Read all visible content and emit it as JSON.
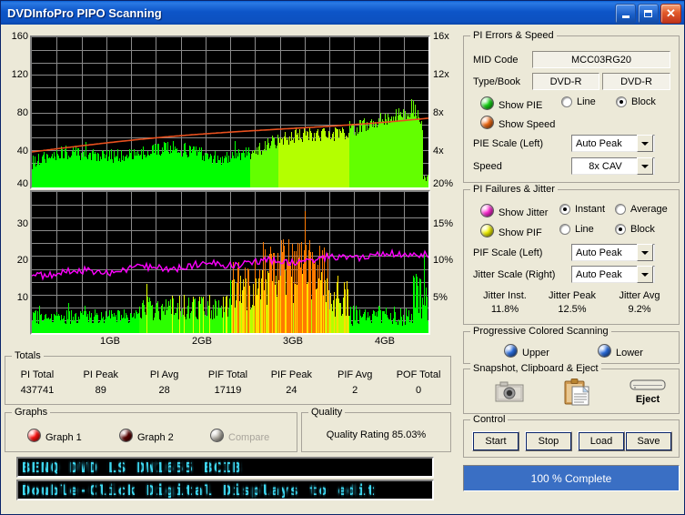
{
  "window": {
    "title": "DVDInfoPro PIPO Scanning",
    "buttons": {
      "minimize": "_",
      "maximize": "□",
      "close": "✕"
    }
  },
  "chart_data": [
    {
      "type": "bar",
      "title": "PI Errors & Speed",
      "xlabel": "",
      "ylabel": "PI Errors",
      "xticks": [
        "1GB",
        "2GB",
        "3GB",
        "4GB"
      ],
      "yticks_left": [
        160,
        120,
        80,
        40
      ],
      "ylim_left": [
        0,
        180
      ],
      "yticks_right": [
        "16x",
        "12x",
        "8x",
        "4x"
      ],
      "ylim_right": [
        0,
        18
      ],
      "grid": true,
      "series": [
        {
          "name": "PI Errors",
          "color": "#00ff00",
          "kind": "block"
        },
        {
          "name": "Speed",
          "color": "#e8501e",
          "kind": "line"
        }
      ]
    },
    {
      "type": "bar",
      "title": "PI Failures & Jitter",
      "xlabel": "",
      "ylabel": "PI Failures",
      "xticks": [
        "1GB",
        "2GB",
        "3GB",
        "4GB"
      ],
      "yticks_left": [
        40,
        30,
        20,
        10
      ],
      "ylim_left": [
        0,
        44
      ],
      "yticks_right": [
        "20%",
        "15%",
        "10%",
        "5%"
      ],
      "ylim_right": [
        0,
        22
      ],
      "grid": true,
      "series": [
        {
          "name": "PI Failures",
          "color": "#00ff00",
          "kind": "block"
        },
        {
          "name": "Jitter",
          "color": "#ff00ff",
          "kind": "line"
        }
      ]
    }
  ],
  "totals": {
    "caption": "Totals",
    "headers": [
      "PI Total",
      "PI Peak",
      "PI Avg",
      "PIF Total",
      "PIF Peak",
      "PIF Avg",
      "POF Total"
    ],
    "values": [
      "437741",
      "89",
      "28",
      "17119",
      "24",
      "2",
      "0"
    ]
  },
  "graphs_box": {
    "caption": "Graphs",
    "items": [
      {
        "label": "Graph 1",
        "color": "#ff1010",
        "enabled": true
      },
      {
        "label": "Graph 2",
        "color": "#5a0000",
        "enabled": true
      },
      {
        "label": "Compare",
        "color": "#b9b5ac",
        "enabled": false
      }
    ]
  },
  "quality": {
    "caption": "Quality",
    "text": "Quality Rating 85.03%"
  },
  "digital_displays": [
    "BENQ    DVD LS DW1655 BCIB",
    "Double-Click Digital Displays to edit"
  ],
  "pi_errors_panel": {
    "caption": "PI Errors & Speed",
    "mid_code_label": "MID Code",
    "mid_code_value": "MCC03RG20",
    "type_book_label": "Type/Book",
    "type_value": "DVD-R",
    "book_value": "DVD-R",
    "show_pie_label": "Show PIE",
    "show_pie_color": "#18d418",
    "show_speed_label": "Show Speed",
    "show_speed_color": "#f06a14",
    "line_label": "Line",
    "block_label": "Block",
    "line_selected": false,
    "block_selected": true,
    "pie_scale_label": "PIE Scale (Left)",
    "pie_scale_value": "Auto Peak",
    "speed_label": "Speed",
    "speed_value": "8x CAV"
  },
  "pi_failures_panel": {
    "caption": "PI Failures & Jitter",
    "show_jitter_label": "Show Jitter",
    "show_jitter_color": "#ff2ad4",
    "show_pif_label": "Show PIF",
    "show_pif_color": "#f2f200",
    "instant_label": "Instant",
    "average_label": "Average",
    "instant_selected": true,
    "average_selected": false,
    "line_label": "Line",
    "block_label": "Block",
    "line_selected": false,
    "block_selected": true,
    "pif_scale_label": "PIF Scale (Left)",
    "pif_scale_value": "Auto Peak",
    "jitter_scale_label": "Jitter Scale (Right)",
    "jitter_scale_value": "Auto Peak",
    "jitter_headers": [
      "Jitter Inst.",
      "Jitter Peak",
      "Jitter Avg"
    ],
    "jitter_values": [
      "11.8%",
      "12.5%",
      "9.2%"
    ]
  },
  "progressive_panel": {
    "caption": "Progressive Colored Scanning",
    "upper_label": "Upper",
    "lower_label": "Lower",
    "led_color": "#2a6ee0"
  },
  "snapshot_panel": {
    "caption": "Snapshot,  Clipboard  & Eject",
    "camera_name": "Snapshot",
    "clipboard_name": "Clipboard",
    "eject_label": "Eject"
  },
  "control_panel": {
    "caption": "Control",
    "buttons": [
      "Start",
      "Stop",
      "Load",
      "Save"
    ]
  },
  "progress": {
    "text": "100 % Complete",
    "percent": 100,
    "color": "#3a6fc4"
  }
}
